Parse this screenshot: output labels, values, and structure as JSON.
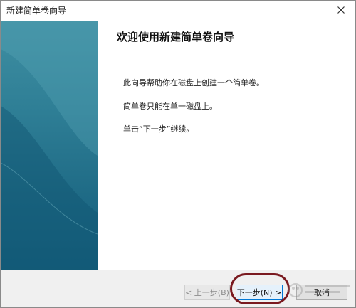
{
  "window": {
    "title": "新建简单卷向导"
  },
  "content": {
    "heading": "欢迎使用新建简单卷向导",
    "paragraphs": [
      "此向导帮助你在磁盘上创建一个简单卷。",
      "简单卷只能在单一磁盘上。",
      "单击“下一步”继续。"
    ]
  },
  "footer": {
    "back_label": "< 上一步(B)",
    "next_label": "下一步(N) >",
    "cancel_label": "取消"
  },
  "colors": {
    "accent": "#0078d7",
    "panel_top": "#3f8fa2",
    "panel_bottom": "#145f7d",
    "highlight_ring": "#7a1a20"
  },
  "icons": {
    "close": "close-icon",
    "watermark": "watermark-logo"
  }
}
